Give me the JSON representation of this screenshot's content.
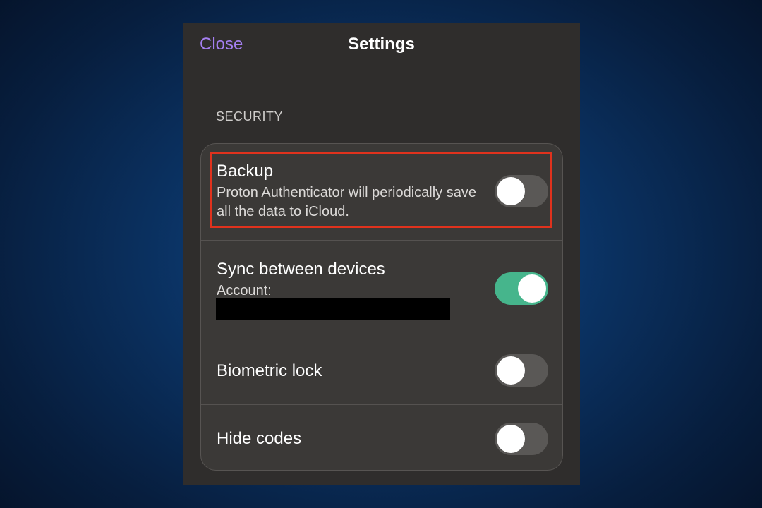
{
  "header": {
    "close_label": "Close",
    "title": "Settings"
  },
  "section": {
    "header": "SECURITY"
  },
  "settings": [
    {
      "title": "Backup",
      "subtitle": "Proton Authenticator will periodically save all the data to iCloud.",
      "toggle_on": false,
      "highlighted": true
    },
    {
      "title": "Sync between devices",
      "subtitle": "Account:",
      "toggle_on": true,
      "account_redacted": true
    },
    {
      "title": "Biometric lock",
      "toggle_on": false
    },
    {
      "title": "Hide codes",
      "toggle_on": false
    }
  ],
  "colors": {
    "accent": "#a47ff0",
    "toggle_on": "#46b58c",
    "toggle_off": "#5a5856",
    "highlight": "#e0321d"
  }
}
